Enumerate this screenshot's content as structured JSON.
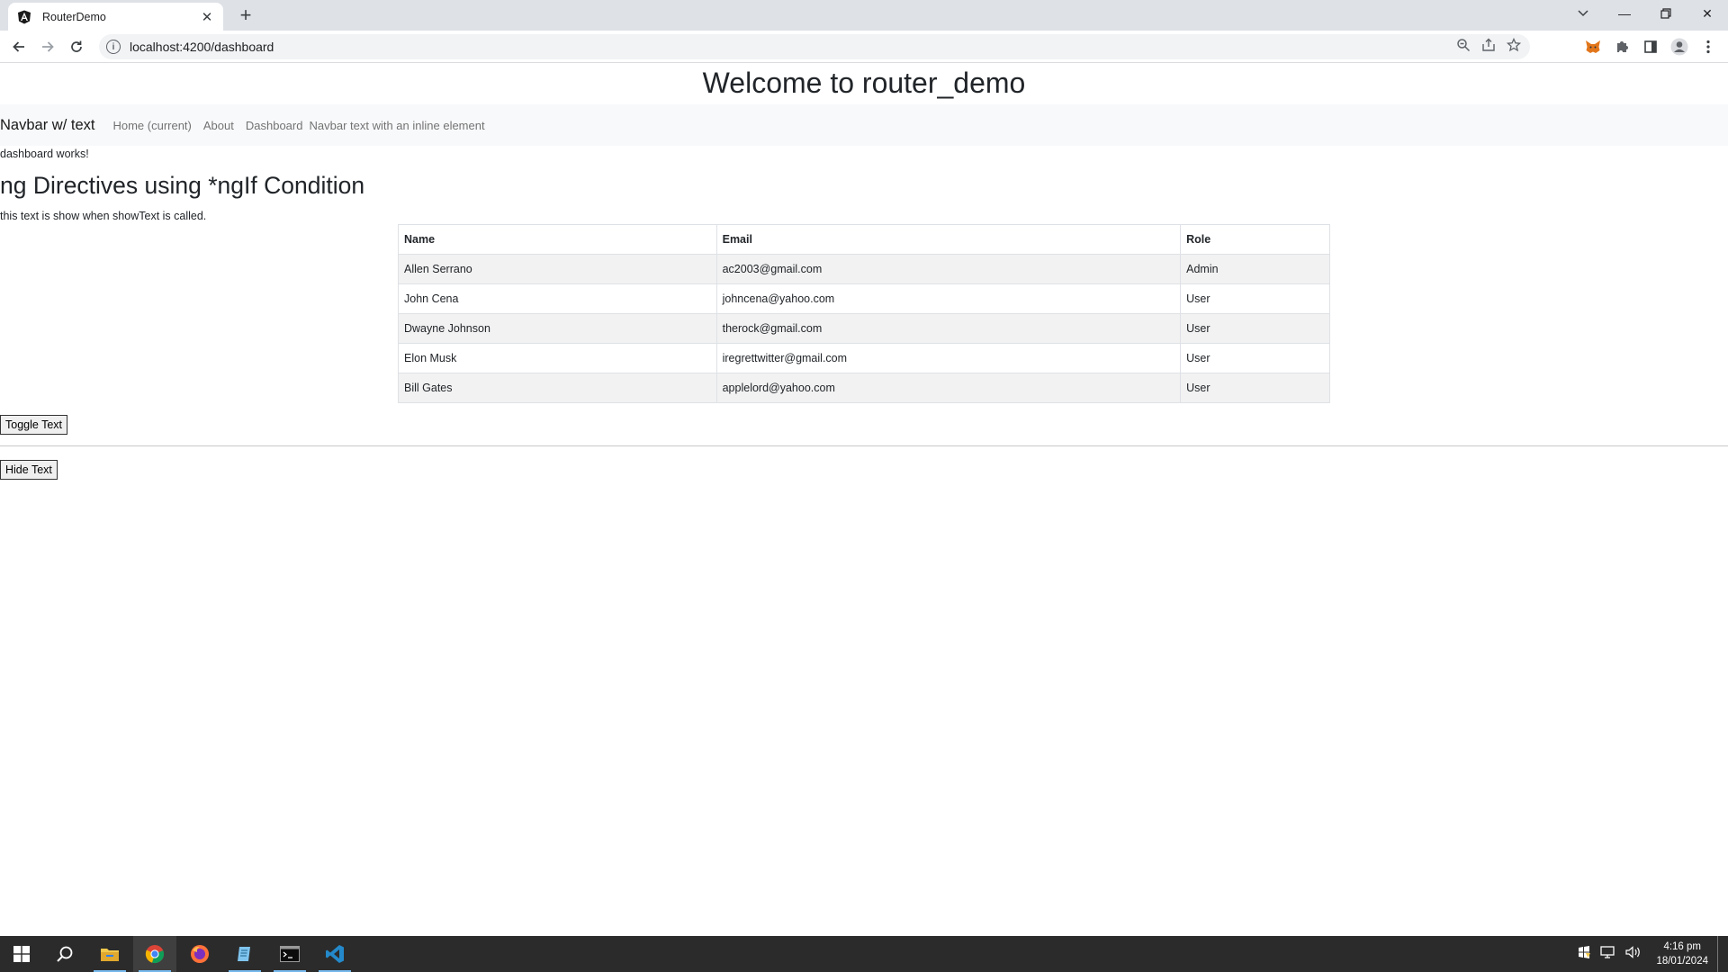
{
  "browser": {
    "tab_title": "RouterDemo",
    "url": "localhost:4200/dashboard"
  },
  "page": {
    "title": "Welcome to router_demo",
    "navbar": {
      "brand": "Navbar w/ text",
      "links": [
        "Home (current)",
        "About",
        "Dashboard"
      ],
      "text": "Navbar text with an inline element"
    },
    "dashboard_text": "dashboard works!",
    "directive_heading": "ng Directives using *ngIf Condition",
    "show_text": "this text is show when showText is called.",
    "table": {
      "headers": [
        "Name",
        "Email",
        "Role"
      ],
      "rows": [
        [
          "Allen Serrano",
          "ac2003@gmail.com",
          "Admin"
        ],
        [
          "John Cena",
          "johncena@yahoo.com",
          "User"
        ],
        [
          "Dwayne Johnson",
          "therock@gmail.com",
          "User"
        ],
        [
          "Elon Musk",
          "iregrettwitter@gmail.com",
          "User"
        ],
        [
          "Bill Gates",
          "applelord@yahoo.com",
          "User"
        ]
      ]
    },
    "toggle_button": "Toggle Text",
    "hide_button": "Hide Text"
  },
  "taskbar": {
    "time": "4:16 pm",
    "date": "18/01/2024"
  },
  "icons": {
    "favicon": "angular-icon",
    "back": "back-arrow-icon",
    "forward": "forward-arrow-icon",
    "reload": "reload-icon",
    "zoom": "zoom-icon",
    "share": "share-icon",
    "bookmark": "star-icon",
    "extension": "metamask-icon",
    "extensions": "puzzle-icon",
    "sidepanel": "side-panel-icon",
    "profile": "profile-icon",
    "menu": "kebab-menu-icon"
  },
  "colors": {
    "tabstrip": "#dee1e6",
    "navbar_bg": "#f8f9fa",
    "striped_row": "#f2f2f2",
    "taskbar": "#2b2b2b"
  }
}
